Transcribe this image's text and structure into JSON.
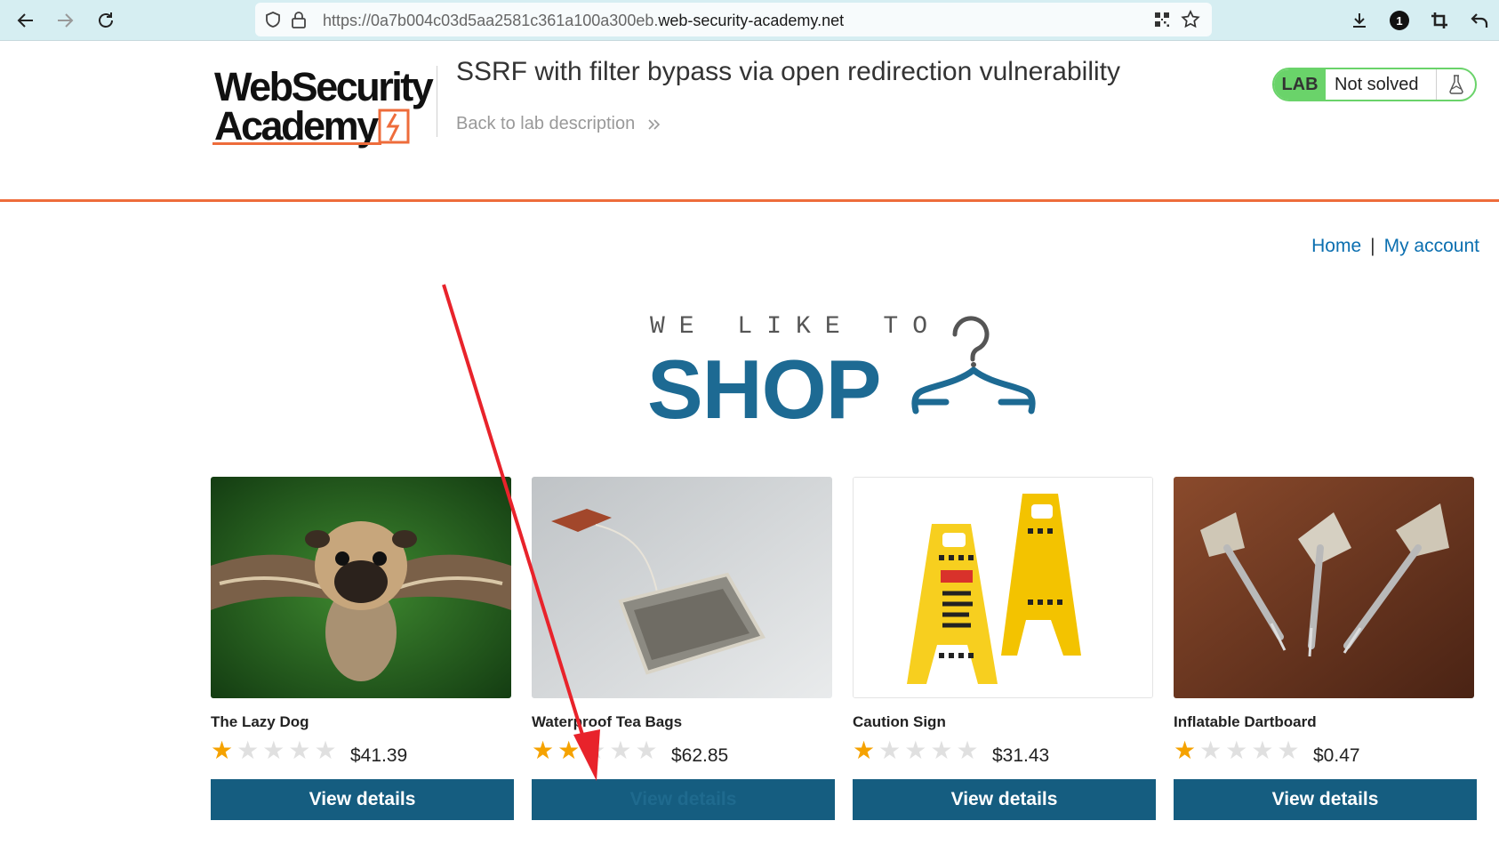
{
  "browser": {
    "url_prefix": "https://0a7b004c03d5aa2581c361a100a300eb.",
    "url_host": "web-security-academy.net",
    "extension_badge": "1"
  },
  "header": {
    "logo_line1": "WebSecurity",
    "logo_line2": "Academy",
    "lab_title": "SSRF with filter bypass via open redirection vulnerability",
    "back_link": "Back to lab description",
    "lab_tag": "LAB",
    "lab_status": "Not solved"
  },
  "nav": {
    "home": "Home",
    "separator": "|",
    "my_account": "My account"
  },
  "banner": {
    "small": "WE LIKE TO",
    "big": "SHOP"
  },
  "products": [
    {
      "name": "The Lazy Dog",
      "rating": 1,
      "price": "$41.39",
      "button": "View details"
    },
    {
      "name": "Waterproof Tea Bags",
      "rating": 2,
      "price": "$62.85",
      "button": "View details"
    },
    {
      "name": "Caution Sign",
      "rating": 1,
      "price": "$31.43",
      "button": "View details"
    },
    {
      "name": "Inflatable Dartboard",
      "rating": 1,
      "price": "$0.47",
      "button": "View details"
    }
  ],
  "colors": {
    "accent_orange": "#ee6c3b",
    "brand_blue": "#1d6a93",
    "button_blue": "#155d80",
    "lab_green": "#6ad36a",
    "annotation_red": "#e8232b"
  }
}
